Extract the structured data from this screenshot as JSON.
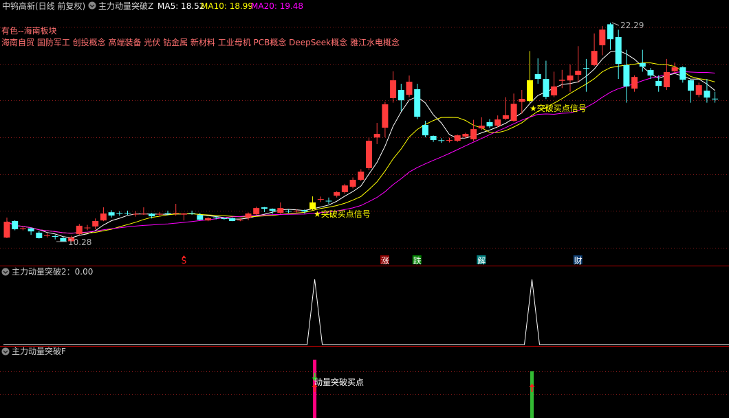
{
  "header": {
    "stock_title": "中钨高新(日线 前复权)",
    "indicator_name": "主力动量突破Z",
    "ma5_label": "MA5: 18.52",
    "ma10_label": "MA10: 18.99",
    "ma20_label": "MA20: 19.48",
    "sector": "有色--海南板块",
    "concepts": "海南自贸 国防军工 创投概念 高端装备 光伏 钴金属 新材料 工业母机 PCB概念 DeepSeek概念 雅江水电概念"
  },
  "main_panel": {
    "low_label": "10.28",
    "high_label": "22.29",
    "signal_label_1": "★突破买点信号",
    "signal_label_2": "★突破买点信号",
    "markers": [
      {
        "text": "S",
        "index": 22,
        "bg": "",
        "color": "#ff2020"
      },
      {
        "text": "涨",
        "index": 47,
        "bg": "#8b0000",
        "color": "#ffffff"
      },
      {
        "text": "跌",
        "index": 51,
        "bg": "#008000",
        "color": "#ffffff"
      },
      {
        "text": "解",
        "index": 59,
        "bg": "#008080",
        "color": "#ffffff"
      },
      {
        "text": "财",
        "index": 71,
        "bg": "#0a3a6e",
        "color": "#ffffff"
      }
    ]
  },
  "panel2": {
    "title": "主力动量突破2：0.00"
  },
  "panel3": {
    "title": "主力动量突破F",
    "label": "动量突破买点"
  },
  "colors": {
    "up": "#ff3b3b",
    "down": "#54ffff",
    "breakout": "#ffff00",
    "ma5": "#ffffff",
    "ma10": "#ffff00",
    "ma20": "#ff00ff",
    "grid": "#8b1a1a",
    "separator": "#c00000",
    "bar_pink": "#ff0080",
    "bar_green": "#33bb33"
  },
  "chart_data": {
    "type": "candlestick",
    "title": "中钨高新(日线 前复权)",
    "ylim": [
      10.28,
      22.29
    ],
    "ohlc_order": [
      "open",
      "high",
      "low",
      "close"
    ],
    "ohlc": [
      [
        10.5,
        11.6,
        10.47,
        11.37
      ],
      [
        11.41,
        11.45,
        10.9,
        10.96
      ],
      [
        10.97,
        11.1,
        10.9,
        11.01
      ],
      [
        11.01,
        11.05,
        10.65,
        10.84
      ],
      [
        10.77,
        10.85,
        10.45,
        10.47
      ],
      [
        10.6,
        10.75,
        10.5,
        10.63
      ],
      [
        10.58,
        10.65,
        10.4,
        10.54
      ],
      [
        10.47,
        10.55,
        10.28,
        10.3
      ],
      [
        10.3,
        10.6,
        10.28,
        10.5
      ],
      [
        10.69,
        11.25,
        10.65,
        11.15
      ],
      [
        11.02,
        11.2,
        10.9,
        11.05
      ],
      [
        11.11,
        11.55,
        10.95,
        11.41
      ],
      [
        11.44,
        12.16,
        11.4,
        11.82
      ],
      [
        11.89,
        12.0,
        11.6,
        11.71
      ],
      [
        11.84,
        11.95,
        11.7,
        11.81
      ],
      [
        11.86,
        11.98,
        11.75,
        11.85
      ],
      [
        11.78,
        11.95,
        11.65,
        11.8
      ],
      [
        11.78,
        12.16,
        11.75,
        11.81
      ],
      [
        11.81,
        11.85,
        11.55,
        11.67
      ],
      [
        11.77,
        11.9,
        11.65,
        11.8
      ],
      [
        11.84,
        11.98,
        11.72,
        11.82
      ],
      [
        11.82,
        12.35,
        11.7,
        11.85
      ],
      [
        11.76,
        11.85,
        11.44,
        11.82
      ],
      [
        11.84,
        11.98,
        11.75,
        11.82
      ],
      [
        11.74,
        11.85,
        11.45,
        11.48
      ],
      [
        11.44,
        11.62,
        11.4,
        11.56
      ],
      [
        11.6,
        11.68,
        11.5,
        11.59
      ],
      [
        11.56,
        11.62,
        11.48,
        11.55
      ],
      [
        11.56,
        11.6,
        11.4,
        11.41
      ],
      [
        11.46,
        11.56,
        11.4,
        11.48
      ],
      [
        11.59,
        11.88,
        11.45,
        11.82
      ],
      [
        11.78,
        12.2,
        11.75,
        12.12
      ],
      [
        12.16,
        12.18,
        11.9,
        12.08
      ],
      [
        12.08,
        12.1,
        11.8,
        11.97
      ],
      [
        11.86,
        12.43,
        11.8,
        12.12
      ],
      [
        11.97,
        12.05,
        11.85,
        11.95
      ],
      [
        11.95,
        12.05,
        11.88,
        11.97
      ],
      [
        12.01,
        12.04,
        11.82,
        11.93
      ],
      [
        12.05,
        12.76,
        12.0,
        12.43
      ],
      [
        12.58,
        12.75,
        12.45,
        12.61
      ],
      [
        12.52,
        12.7,
        12.35,
        12.5
      ],
      [
        12.8,
        13.05,
        12.7,
        12.99
      ],
      [
        12.99,
        13.45,
        12.9,
        13.36
      ],
      [
        13.29,
        13.8,
        13.2,
        13.67
      ],
      [
        13.67,
        14.25,
        13.6,
        14.12
      ],
      [
        14.31,
        16.0,
        14.2,
        15.81
      ],
      [
        15.99,
        16.79,
        15.63,
        16.19
      ],
      [
        16.53,
        17.95,
        16.0,
        17.81
      ],
      [
        18.15,
        19.62,
        17.9,
        19.13
      ],
      [
        18.6,
        18.94,
        17.43,
        18.03
      ],
      [
        18.33,
        19.39,
        18.2,
        19.05
      ],
      [
        18.64,
        18.94,
        17.0,
        17.13
      ],
      [
        16.68,
        16.91,
        16.0,
        16.11
      ],
      [
        16.08,
        16.1,
        15.75,
        15.85
      ],
      [
        15.84,
        15.95,
        15.7,
        15.81
      ],
      [
        15.83,
        15.98,
        15.72,
        15.85
      ],
      [
        15.81,
        16.15,
        15.75,
        16.11
      ],
      [
        16.04,
        16.25,
        15.95,
        16.19
      ],
      [
        15.89,
        16.96,
        15.8,
        16.45
      ],
      [
        16.49,
        17.1,
        16.4,
        16.64
      ],
      [
        16.83,
        17.0,
        16.5,
        16.6
      ],
      [
        16.64,
        17.2,
        16.55,
        16.98
      ],
      [
        17.02,
        18.2,
        16.95,
        17.21
      ],
      [
        16.9,
        18.4,
        16.85,
        17.84
      ],
      [
        17.95,
        18.6,
        17.3,
        18.11
      ],
      [
        17.99,
        20.73,
        17.9,
        19.13
      ],
      [
        19.47,
        20.33,
        18.94,
        19.2
      ],
      [
        19.2,
        20.2,
        18.1,
        18.22
      ],
      [
        18.3,
        19.6,
        18.2,
        18.79
      ],
      [
        19.1,
        19.7,
        18.7,
        19.16
      ],
      [
        19.12,
        20.0,
        18.5,
        19.39
      ],
      [
        19.43,
        21.0,
        19.0,
        19.65
      ],
      [
        19.8,
        20.3,
        18.5,
        19.76
      ],
      [
        19.96,
        21.7,
        19.9,
        20.74
      ],
      [
        21.05,
        22.1,
        20.5,
        21.91
      ],
      [
        22.2,
        22.29,
        20.8,
        21.38
      ],
      [
        21.5,
        21.9,
        19.2,
        20.03
      ],
      [
        19.96,
        20.8,
        17.9,
        18.79
      ],
      [
        18.67,
        19.4,
        18.5,
        19.31
      ],
      [
        20.07,
        20.8,
        19.6,
        19.88
      ],
      [
        19.69,
        19.8,
        19.2,
        19.39
      ],
      [
        19.09,
        19.4,
        18.5,
        18.82
      ],
      [
        18.75,
        20.3,
        18.6,
        19.58
      ],
      [
        19.62,
        20.1,
        19.5,
        19.84
      ],
      [
        19.84,
        19.9,
        19.0,
        19.16
      ],
      [
        19.13,
        19.2,
        17.9,
        18.56
      ],
      [
        18.33,
        19.0,
        18.2,
        18.86
      ],
      [
        18.56,
        19.2,
        17.9,
        18.18
      ],
      [
        18.12,
        18.5,
        17.9,
        18.1
      ]
    ],
    "breakout_candles": [
      38,
      65
    ],
    "moving_averages": [
      {
        "name": "MA5",
        "period": 5
      },
      {
        "name": "MA10",
        "period": 10
      },
      {
        "name": "MA20",
        "period": 20
      }
    ],
    "panel2_signal": {
      "name": "主力动量突破2",
      "value": 0.0,
      "peaks_at": [
        38,
        65
      ],
      "peak_value": 1
    },
    "panel3_bars": [
      {
        "index": 38,
        "color": "pink"
      },
      {
        "index": 65,
        "color": "green"
      }
    ]
  }
}
